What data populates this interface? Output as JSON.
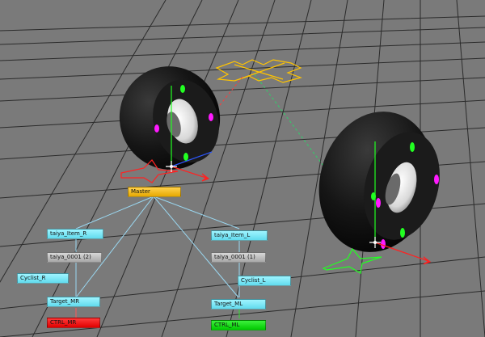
{
  "nodes": {
    "master": "Master",
    "taiya_item_r": "taiya_Item_R",
    "taiya_item_l": "taiya_Item_L",
    "taiya_0001_2": "taiya_0001 (2)",
    "taiya_0001_1": "taiya_0001 (1)",
    "cyclist_r": "Cyclist_R",
    "cyclist_l": "Cyclist_L",
    "target_mr": "Target_MR",
    "target_ml": "Target_ML",
    "ctrl_mr": "CTRL_MR",
    "ctrl_ml": "CTRL_ML"
  },
  "colors": {
    "viewport_bg": "#7a7a7a",
    "grid_line": "#2b2b2b",
    "tire_dark": "#141414",
    "wheel_hub": "#f0f0f0",
    "marker_magenta": "#ff1aff",
    "marker_green": "#22ff22",
    "master_control": "#ffc400",
    "ctrl_red": "#ff1a1a",
    "ctrl_green": "#22ee22",
    "connection_line": "#9ad8f2"
  },
  "icons": [
    "move-manipulator-icon",
    "x-axis-arrow-icon",
    "y-axis-icon",
    "z-axis-arrow-icon"
  ]
}
